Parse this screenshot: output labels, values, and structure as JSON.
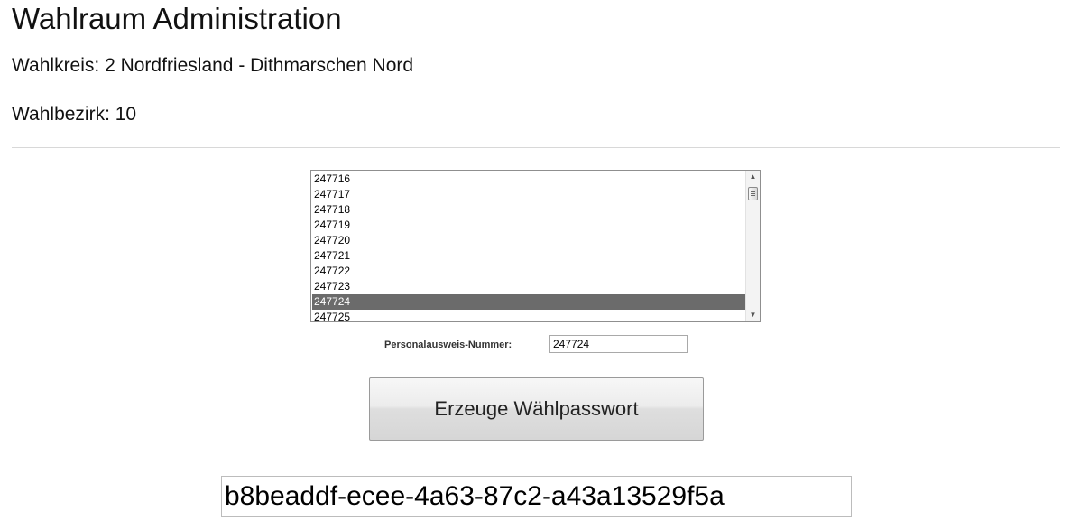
{
  "header": {
    "title": "Wahlraum Administration",
    "wahlkreis": "Wahlkreis: 2 Nordfriesland - Dithmarschen Nord",
    "wahlbezirk": "Wahlbezirk: 10"
  },
  "id_list": {
    "items": [
      "247716",
      "247717",
      "247718",
      "247719",
      "247720",
      "247721",
      "247722",
      "247723",
      "247724",
      "247725"
    ],
    "selected": "247724",
    "selected_color": "#6b6b6b"
  },
  "id_field": {
    "label": "Personalausweis-Nummer:",
    "value": "247724"
  },
  "generate_button": {
    "label": "Erzeuge Wählpasswort"
  },
  "password": {
    "value": "b8beaddf-ecee-4a63-87c2-a43a13529f5a"
  }
}
